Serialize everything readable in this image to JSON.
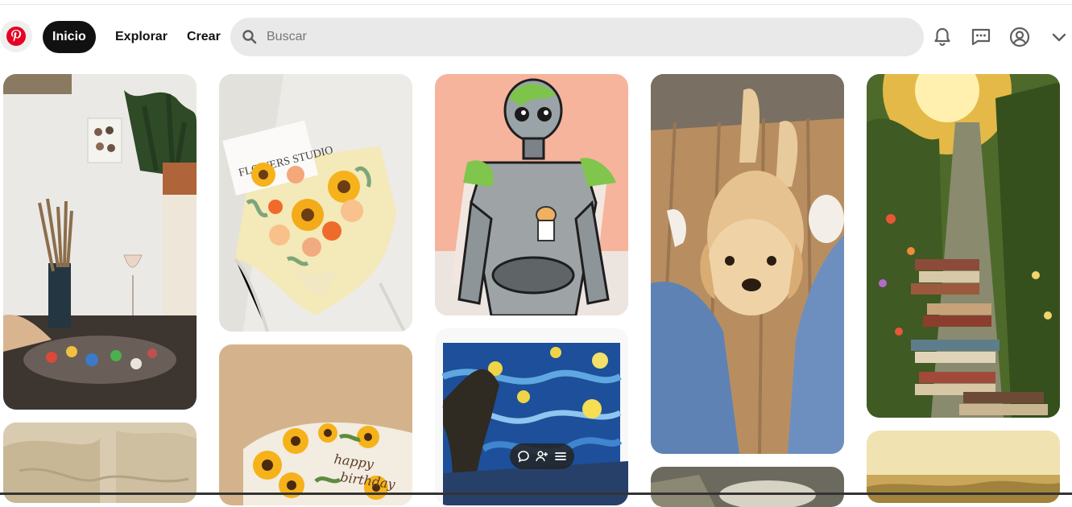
{
  "nav": {
    "logo": "pinterest-logo",
    "home_label": "Inicio",
    "explore_label": "Explorar",
    "create_label": "Crear"
  },
  "search": {
    "placeholder": "Buscar"
  },
  "header_icons": [
    "bell-icon",
    "messages-icon",
    "profile-icon",
    "chevron-down-icon"
  ],
  "pins": [
    {
      "column": 1,
      "subject": "art-studio-easel",
      "image_text": ""
    },
    {
      "column": 1,
      "subject": "armchair"
    },
    {
      "column": 2,
      "subject": "flower-bouquet",
      "image_text": "FLOWERS STUDIO"
    },
    {
      "column": 2,
      "subject": "sunflower-cake",
      "image_text": "happy birthday"
    },
    {
      "column": 3,
      "subject": "robot-illustration"
    },
    {
      "column": 3,
      "subject": "starry-night-painting"
    },
    {
      "column": 4,
      "subject": "golden-puppy"
    },
    {
      "column": 4,
      "subject": "plants"
    },
    {
      "column": 5,
      "subject": "garden-books-path"
    },
    {
      "column": 5,
      "subject": "sunset-field"
    }
  ],
  "hover_actions": [
    "comment-icon",
    "add-person-icon",
    "menu-icon"
  ],
  "colors": {
    "brand": "#e60023",
    "active_nav": "#111111",
    "search_bg": "#e9e9e9"
  }
}
